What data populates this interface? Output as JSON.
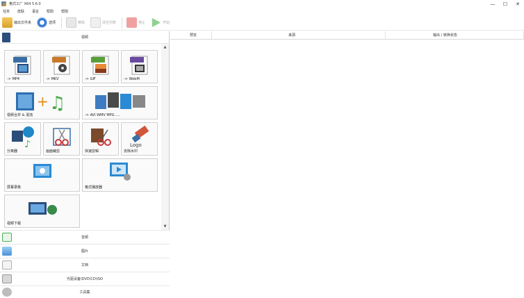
{
  "window": {
    "title": "格式工厂 X64 5.6.0",
    "minimize": "—",
    "maximize": "☐",
    "close": "✕"
  },
  "menu": [
    "任务",
    "皮肤",
    "语言",
    "帮助",
    "帮助"
  ],
  "toolbar": {
    "output_folder": "输出文件夹",
    "options": "选项",
    "remove": "移除",
    "clear_list": "清空列表",
    "stop": "停止",
    "start": "开始"
  },
  "left": {
    "video_category": "视频",
    "tiles": [
      {
        "label": "-> MP4",
        "badge": "MP4",
        "color": "#3a6ea5"
      },
      {
        "label": "-> MKV",
        "badge": "MKV",
        "color": "#c87a2a"
      },
      {
        "label": "-> GIF",
        "badge": "GIF",
        "color": "#5a9e3a"
      },
      {
        "label": "-> WebM",
        "badge": "WebM",
        "color": "#6a4aa0"
      },
      {
        "label": "视频合并 & 混流",
        "badge": "",
        "color": "#2c6fb0"
      },
      {
        "label": "-> AVI WMV MPG ....",
        "badge": "",
        "color": "#3d7cc0"
      },
      {
        "label": "分离器",
        "badge": "",
        "color": "#1e88c8"
      },
      {
        "label": "画面裁剪",
        "badge": "",
        "color": "#c83a3a"
      },
      {
        "label": "快速剪辑",
        "badge": "",
        "color": "#7a4a2a"
      },
      {
        "label": "去除水印",
        "badge": "",
        "color": "#d2553a"
      },
      {
        "label": "屏幕录像",
        "badge": "",
        "color": "#2a8ad4"
      },
      {
        "label": "格式播放器",
        "badge": "",
        "color": "#2a8ad4"
      },
      {
        "label": "视频下载",
        "badge": "",
        "color": "#2a6aa0"
      }
    ],
    "categories": [
      {
        "label": "音频",
        "color": "#4caf50"
      },
      {
        "label": "图片",
        "color": "#4a90d9"
      },
      {
        "label": "文档",
        "color": "#7a7a7a"
      },
      {
        "label": "光驱设备\\DVD\\CD\\ISO",
        "color": "#6a6a6a"
      },
      {
        "label": "工具集",
        "color": "#8a8a8a"
      }
    ]
  },
  "list": {
    "col_preview": "预览",
    "col_source": "来源",
    "col_output": "输出 / 转换状态"
  }
}
